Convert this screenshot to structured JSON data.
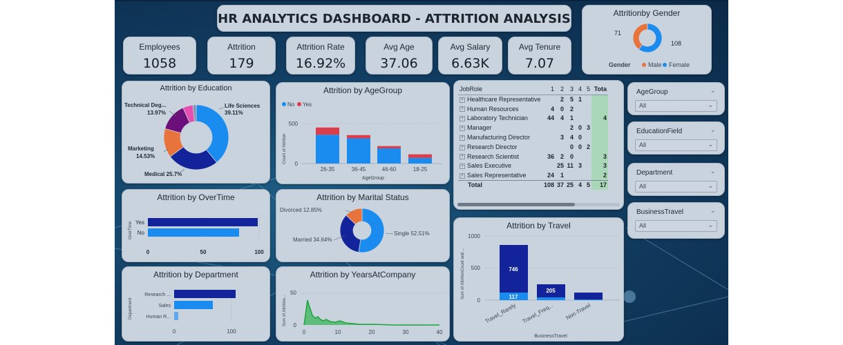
{
  "title": "HR ANALYTICS DASHBOARD - ATTRITION ANALYSIS",
  "kpis": [
    {
      "label": "Employees",
      "value": "1058"
    },
    {
      "label": "Attrition",
      "value": "179"
    },
    {
      "label": "Attrition Rate",
      "value": "16.92%"
    },
    {
      "label": "Avg Age",
      "value": "37.06"
    },
    {
      "label": "Avg Salary",
      "value": "6.63K"
    },
    {
      "label": "Avg Tenure",
      "value": "7.07"
    }
  ],
  "gender": {
    "title": "Attritionby Gender",
    "legend_title": "Gender",
    "male_label": "Male",
    "female_label": "Female",
    "male_value": "71",
    "female_value": "108",
    "male_color": "#e8743b",
    "female_color": "#1a8cf0"
  },
  "education": {
    "title": "Attrition by Education",
    "labels": [
      "Life Sciences",
      "39.11%",
      "Medical 25.7%",
      "Marketing",
      "14.53%",
      "Technical Deg...",
      "13.97%"
    ]
  },
  "agegroup": {
    "title": "Attrition by AgeGroup",
    "legend_no": "No",
    "legend_yes": "Yes",
    "ylabel": "Count of Attrition",
    "xlabel": "AgeGroup",
    "ticks_y": [
      "0",
      "500"
    ],
    "categories": [
      "26-35",
      "36-45",
      "46-60",
      "18-25"
    ]
  },
  "overtime": {
    "title": "Attrition by OverTime",
    "ylabel": "OverTime",
    "categories": [
      "Yes",
      "No"
    ],
    "ticks_x": [
      "0",
      "50",
      "100"
    ]
  },
  "marital": {
    "title": "Attrition by Marital Status",
    "labels": [
      "Divorced 12.85%",
      "Married 34.64%",
      "Single 52.51%"
    ]
  },
  "department": {
    "title": "Attrition by Department",
    "ylabel": "Department",
    "categories": [
      "Research ...",
      "Sales",
      "Human R..."
    ],
    "ticks_x": [
      "0",
      "100"
    ]
  },
  "years": {
    "title": "Attrition by YearsAtCompany",
    "ylabel": "Sum of Attrition...",
    "ticks_y": [
      "0",
      "50"
    ],
    "ticks_x": [
      "0",
      "10",
      "20",
      "30",
      "40"
    ]
  },
  "travel": {
    "title": "Attrition by Travel",
    "ylabel": "Sum of AttritionCount and ...",
    "xlabel": "BusinessTravel",
    "ticks_y": [
      "0",
      "500",
      "1000"
    ],
    "categories": [
      "Travel_Rarely",
      "Travel_Freq...",
      "Non-Travel"
    ],
    "data_labels": [
      "746",
      "117",
      "205"
    ]
  },
  "matrix": {
    "header": [
      "JobRole",
      "1",
      "2",
      "3",
      "4",
      "5",
      "Tota"
    ],
    "rows": [
      [
        "Healthcare Representative",
        "",
        "2",
        "5",
        "1",
        "",
        ""
      ],
      [
        "Human Resources",
        "4",
        "0",
        "2",
        "",
        "",
        ""
      ],
      [
        "Laboratory Technician",
        "44",
        "4",
        "1",
        "",
        "",
        "4"
      ],
      [
        "Manager",
        "",
        "",
        "2",
        "0",
        "3",
        ""
      ],
      [
        "Manufacturing Director",
        "",
        "3",
        "4",
        "0",
        "",
        ""
      ],
      [
        "Research Director",
        "",
        "",
        "0",
        "0",
        "2",
        ""
      ],
      [
        "Research Scientist",
        "36",
        "2",
        "0",
        "",
        "",
        "3"
      ],
      [
        "Sales Executive",
        "",
        "25",
        "11",
        "3",
        "",
        "3"
      ],
      [
        "Sales Representative",
        "24",
        "1",
        "",
        "",
        "",
        "2"
      ]
    ],
    "total": [
      "Total",
      "108",
      "37",
      "25",
      "4",
      "5",
      "17"
    ]
  },
  "slicers": [
    {
      "label": "AgeGroup",
      "value": "All"
    },
    {
      "label": "EducationField",
      "value": "All"
    },
    {
      "label": "Department",
      "value": "All"
    },
    {
      "label": "BusinessTravel",
      "value": "All"
    }
  ],
  "colors": {
    "dark_blue": "#13239a",
    "light_blue": "#1a8cf0",
    "red": "#dc3d4b",
    "green": "#1aa33a"
  }
}
